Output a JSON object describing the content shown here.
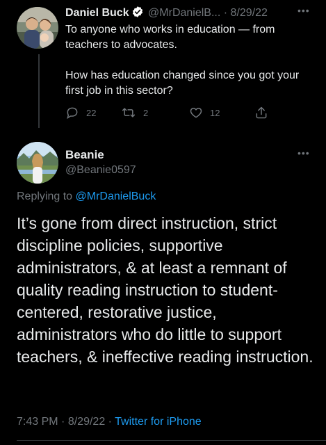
{
  "colors": {
    "background": "#000000",
    "text_primary": "#e7e9ea",
    "text_secondary": "#71767b",
    "link": "#1d9bf0",
    "verified_badge": "#ffffff"
  },
  "parent_tweet": {
    "author_name": "Daniel Buck",
    "verified": true,
    "handle": "@MrDanielB...",
    "separator": "·",
    "date": "8/29/22",
    "text_paragraph_1": "To anyone who works in education — from teachers to advocates.",
    "text_paragraph_2": "How has education changed since you got your first job in this sector?",
    "reply_count": "22",
    "retweet_count": "2",
    "like_count": "12",
    "icons": {
      "more": "more-horizontal-icon",
      "reply": "reply-icon",
      "retweet": "retweet-icon",
      "like": "heart-icon",
      "share": "share-icon"
    }
  },
  "reply_tweet": {
    "author_name": "Beanie",
    "handle": "@Beanie0597",
    "replying_prefix": "Replying to",
    "replying_to": "@MrDanielBuck",
    "text": "It’s gone from direct instruction, strict discipline policies, supportive administrators, & at least a remnant of quality reading instruction to student-centered, restorative justice, administrators who do little to support teachers, & ineffective reading instruction.",
    "time": "7:43 PM",
    "dot": "·",
    "date": "8/29/22",
    "dot2": "·",
    "source": "Twitter for iPhone",
    "icons": {
      "more": "more-horizontal-icon"
    }
  }
}
